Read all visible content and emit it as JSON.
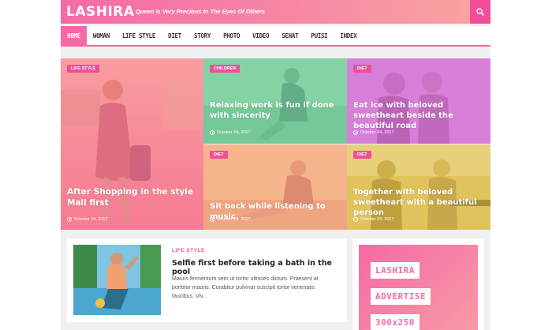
{
  "header": {
    "logo": "LASHIRA",
    "tagline": "Queen Is Very Precious In The Eyes Of Others",
    "search_icon": "search-icon"
  },
  "nav": {
    "items": [
      "HOME",
      "WOMAN",
      "LIFE STYLE",
      "DIET",
      "STORY",
      "PHOTO",
      "VIDEO",
      "SEHAT",
      "PUISI",
      "INDEX"
    ]
  },
  "grid": {
    "tiles": [
      {
        "category": "LIFE STYLE",
        "title": "After Shopping in the style Mall first",
        "date": "October 24, 2017",
        "tint": "#f7869a"
      },
      {
        "category": "CHILDREN",
        "title": "Relaxing work is fun if done with sincerity",
        "date": "October 24, 2017",
        "tint": "#7fd0a0"
      },
      {
        "category": "DIET",
        "title": "Eat ice with beloved sweetheart beside the beautiful road",
        "date": "October 24, 2017",
        "tint": "#d77fd8"
      },
      {
        "category": "DIET",
        "title": "Sit back while listening to music",
        "date": "October 24, 2017",
        "tint": "#f6b38a"
      },
      {
        "category": "DIET",
        "title": "Together with beloved sweetheart with a beautiful person",
        "date": "October 24, 2017",
        "tint": "#e0c35a"
      }
    ]
  },
  "featured": {
    "category": "LIFE STYLE",
    "title": "Selfie first before taking a bath in the pool",
    "excerpt": "Mauris fermentum sem ut tortor ultricies dictum. Praesent at porttitor mauris. Curabitur pulvinar suscipit tortor venenatis faucibus. Viv..."
  },
  "ad": {
    "line1": "LASHIRA",
    "line2": "ADVERTISE",
    "line3": "300x250"
  },
  "colors": {
    "accent": "#f04e9a",
    "header_gradient_start": "#f56aa6",
    "header_gradient_end": "#f9a6a0"
  }
}
